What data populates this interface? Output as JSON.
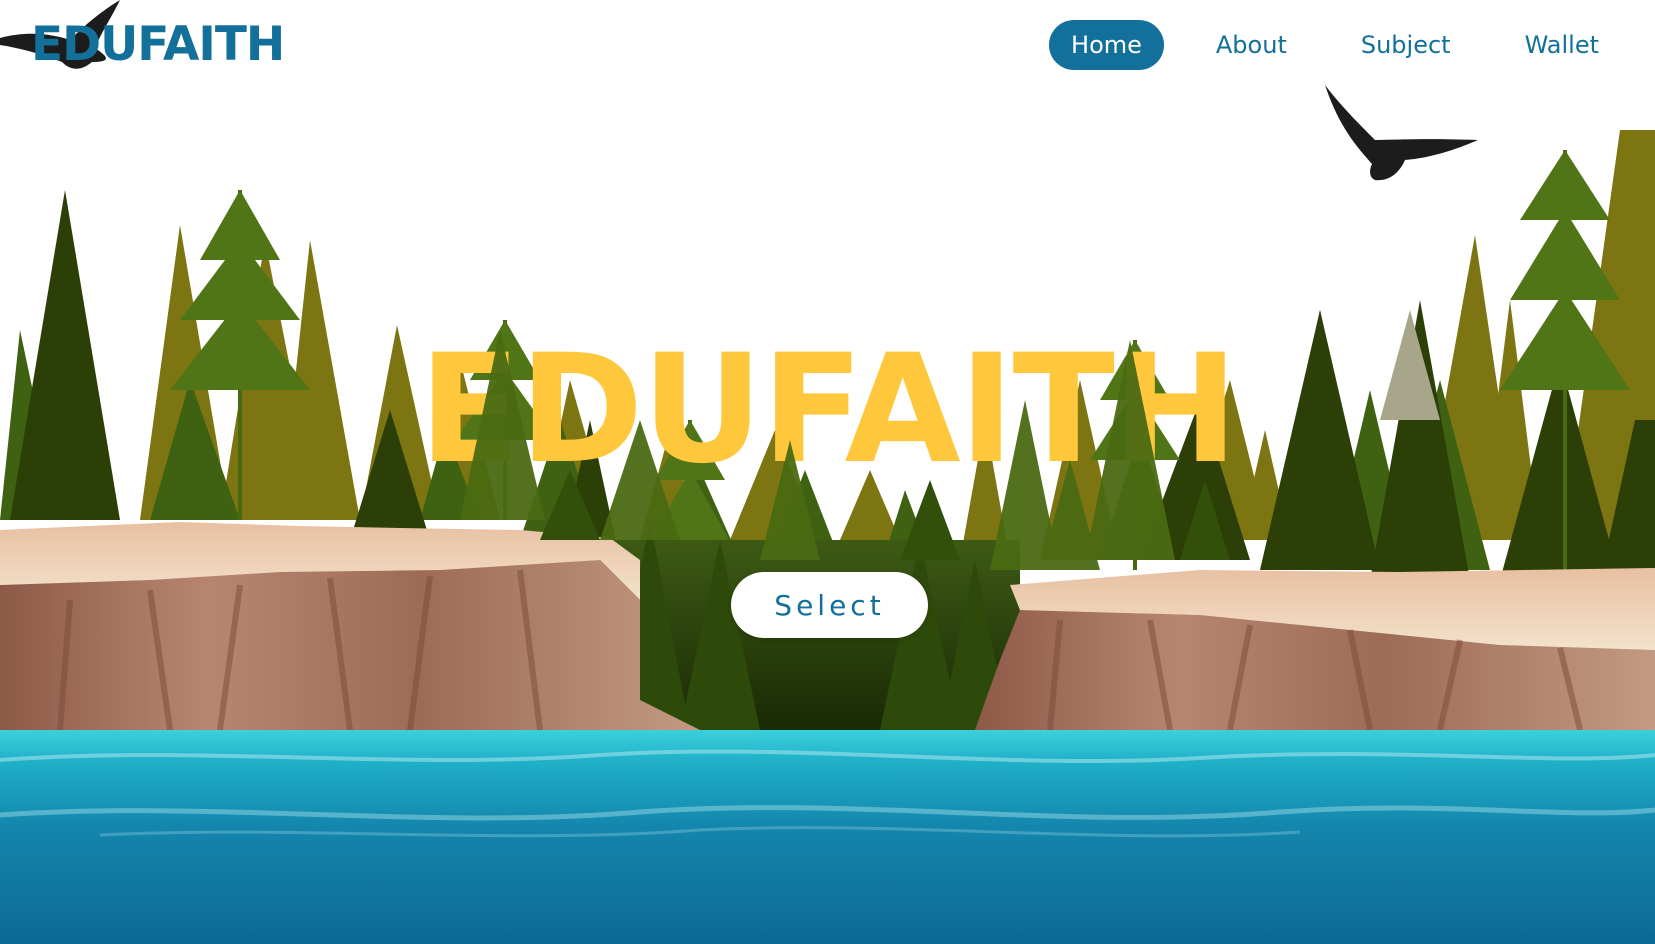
{
  "brand": {
    "logo_text": "EDUFAITH"
  },
  "nav": {
    "items": [
      {
        "label": "Home",
        "active": true
      },
      {
        "label": "About",
        "active": false
      },
      {
        "label": "Subject",
        "active": false
      },
      {
        "label": "Wallet",
        "active": false
      }
    ]
  },
  "hero": {
    "title": "EDUFAITH",
    "button_label": "Select"
  },
  "colors": {
    "brand_blue": "#12709a",
    "title_yellow": "#ffc73c",
    "water_top": "#2bbfcf",
    "water_deep": "#0e6f99",
    "tree_olive": "#7a7410",
    "tree_dark": "#2f4306",
    "cliff_top": "#f0d6bd",
    "cliff_face": "#a5705a"
  },
  "icons": {
    "bird_left": "eagle-silhouette-icon",
    "bird_right": "eagle-silhouette-icon"
  }
}
